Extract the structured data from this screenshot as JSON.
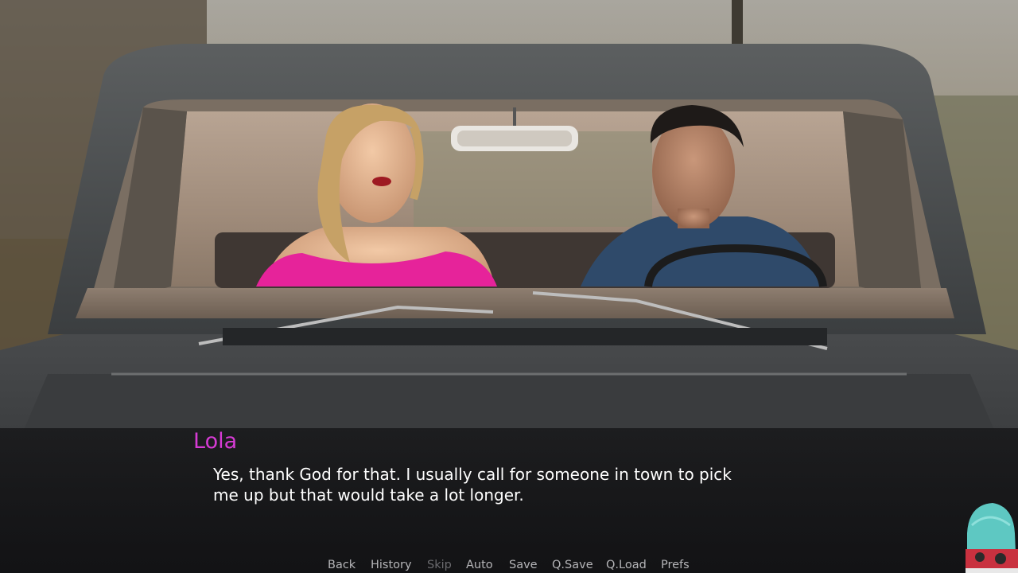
{
  "dialogue": {
    "speaker": "Lola",
    "text": "Yes, thank God for that. I usually call for someone in town to pick\nme up but that would take a lot longer."
  },
  "quick_menu": {
    "back": "Back",
    "history": "History",
    "skip": "Skip",
    "auto": "Auto",
    "save": "Save",
    "qsave": "Q.Save",
    "qload": "Q.Load",
    "prefs": "Prefs"
  },
  "colors": {
    "speaker": "#d63bd4",
    "dialogue_text": "#ffffff",
    "menu_text": "#b5b5b8",
    "menu_disabled": "#6a6a6e"
  }
}
